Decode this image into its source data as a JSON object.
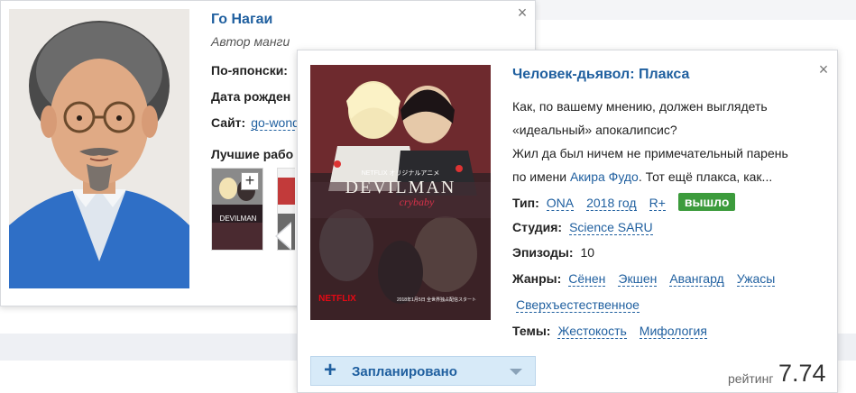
{
  "author": {
    "name": "Го Нагаи",
    "role": "Автор манги",
    "japanese_label": "По-японски:",
    "birth_label": "Дата рожден",
    "site_label": "Сайт:",
    "site_value": "go-wond",
    "best_label": "Лучшие рабо",
    "best_thumb_1_text": "DEVILMAN",
    "plus_button": "+",
    "close": "×"
  },
  "anime": {
    "title": "Человек-дьявол: Плакса",
    "close": "×",
    "description": {
      "line1": "Как, по вашему мнению, должен выглядеть",
      "line2": "«идеальный» апокалипсис?",
      "line3": "Жил да был ничем не примечательный парень",
      "line4_before": "по имени ",
      "line4_link": "Акира Фудо",
      "line4_after": ". Тот ещё плакса, как..."
    },
    "type_label": "Тип:",
    "type_value": "ONA",
    "year_value": "2018 год",
    "rating_age": "R+",
    "status_badge": "вышло",
    "studio_label": "Студия:",
    "studio_value": "Science SARU",
    "episodes_label": "Эпизоды:",
    "episodes_value": "10",
    "genres_label": "Жанры:",
    "genres": [
      "Сёнен",
      "Экшен",
      "Авангард",
      "Ужасы",
      "Сверхъестественное"
    ],
    "themes_label": "Темы:",
    "themes": [
      "Жестокость",
      "Мифология"
    ],
    "poster_logo": "DEVILMAN",
    "poster_sub": "crybaby",
    "poster_brand_top": "NETFLIX オリジナルアニメ",
    "poster_netflix": "NETFLIX",
    "poster_date": "2018年1月5日\n全世界独占配信スタート",
    "plan_button": "Запланировано",
    "plan_plus": "+",
    "rating_label": "рейтинг",
    "rating_value": "7.74"
  },
  "colors": {
    "link": "#1f5f9f",
    "badge": "#3c9b3c",
    "plan_bg": "#d7eaf8"
  }
}
